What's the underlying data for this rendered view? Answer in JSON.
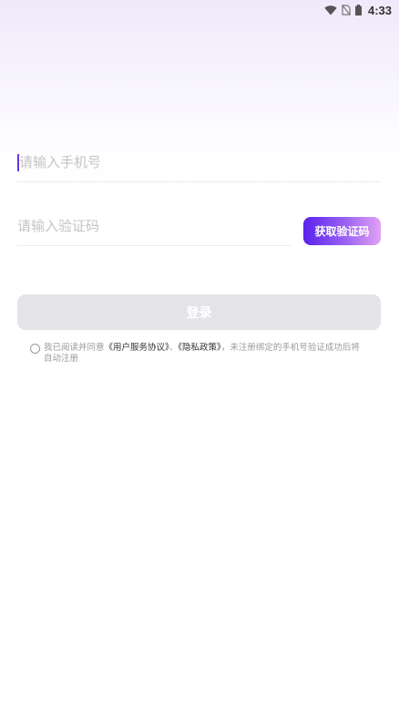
{
  "status_bar": {
    "time": "4:33",
    "icons": [
      "wifi-icon",
      "no-sim-icon",
      "battery-icon"
    ]
  },
  "form": {
    "phone_placeholder": "请输入手机号",
    "code_placeholder": "请输入验证码",
    "get_code_label": "获取验证码",
    "login_label": "登录"
  },
  "agreement": {
    "prefix": "我已阅读并同意",
    "user_agreement": "《用户服务协议》",
    "separator": "、",
    "privacy_policy": "《隐私政策》",
    "suffix": "，未注册绑定的手机号验证成功后将自动注册"
  },
  "colors": {
    "accent_start": "#5a22ee",
    "accent_end": "#e2a2f3",
    "login_disabled": "#e3e3e8"
  }
}
